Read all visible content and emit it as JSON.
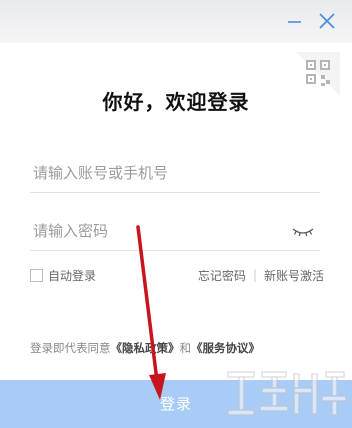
{
  "window": {
    "minimize_icon": "minimize-icon",
    "close_icon": "close-icon"
  },
  "qr_icon": "qr-code-icon",
  "heading": "你好，欢迎登录",
  "account_field": {
    "placeholder": "请输入账号或手机号",
    "value": ""
  },
  "password_field": {
    "placeholder": "请输入密码",
    "value": "",
    "toggle_icon": "eye-closed-icon"
  },
  "options": {
    "auto_login_label": "自动登录",
    "auto_login_checked": false,
    "forgot_password": "忘记密码",
    "separator": "|",
    "activate_new_account": "新账号激活"
  },
  "agreement": {
    "prefix": "登录即代表同意",
    "privacy_policy": "《隐私政策》",
    "conjunction": "和",
    "service_agreement": "《服务协议》"
  },
  "login_button": "登录",
  "colors": {
    "button": "#a9ccf6",
    "annotation_arrow": "#c8141e",
    "titlebar": "#eeeff0"
  }
}
